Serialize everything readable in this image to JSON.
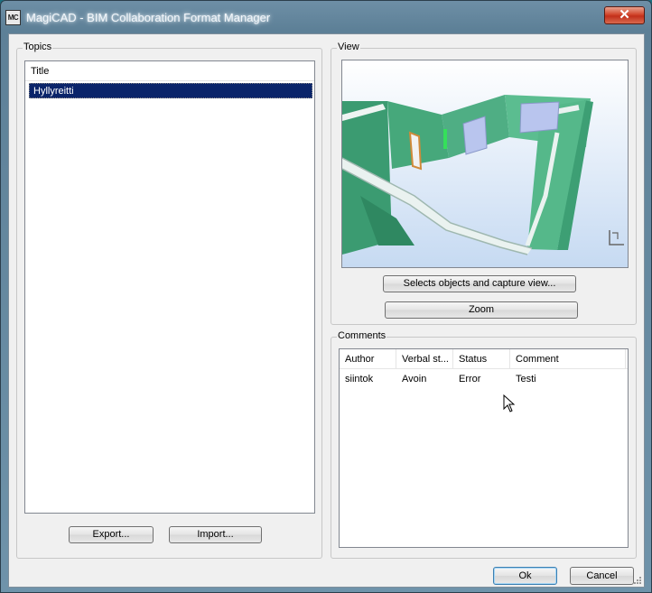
{
  "window": {
    "app_icon": "MC",
    "title": "MagiCAD - BIM Collaboration Format Manager",
    "close_symbol": "✕"
  },
  "topics": {
    "legend": "Topics",
    "column_title": "Title",
    "items": [
      "Hyllyreitti"
    ],
    "export_label": "Export...",
    "import_label": "Import..."
  },
  "view": {
    "legend": "View",
    "capture_label": "Selects objects and capture view...",
    "zoom_label": "Zoom"
  },
  "comments": {
    "legend": "Comments",
    "columns": [
      "Author",
      "Verbal st...",
      "Status",
      "Comment"
    ],
    "rows": [
      {
        "author": "siintok",
        "verbal_status": "Avoin",
        "status": "Error",
        "comment": "Testi"
      }
    ]
  },
  "footer": {
    "ok_label": "Ok",
    "cancel_label": "Cancel"
  },
  "colors": {
    "selection": "#0a246a",
    "wall": "#3fa37a",
    "sky": "#cfe0f5"
  }
}
